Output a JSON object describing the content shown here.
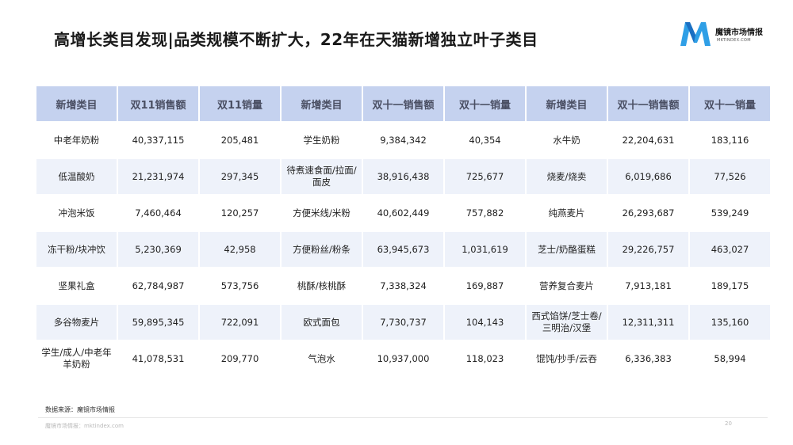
{
  "title": "高增长类目发现|品类规模不断扩大，22年在天猫新增独立叶子类目",
  "logo": {
    "brand": "魔镜市场情报",
    "domain": "MKTINDEX.COM",
    "accent": "#2f9fe6"
  },
  "table": {
    "headers": [
      "新增类目",
      "双11销售额",
      "双11销量",
      "新增类目",
      "双十一销售额",
      "双十一销量",
      "新增类目",
      "双十一销售额",
      "双十一销量"
    ],
    "rows": [
      [
        "中老年奶粉",
        "40,337,115",
        "205,481",
        "学生奶粉",
        "9,384,342",
        "40,354",
        "水牛奶",
        "22,204,631",
        "183,116"
      ],
      [
        "低温酸奶",
        "21,231,974",
        "297,345",
        "待煮速食面/拉面/面皮",
        "38,916,438",
        "725,677",
        "烧麦/烧卖",
        "6,019,686",
        "77,526"
      ],
      [
        "冲泡米饭",
        "7,460,464",
        "120,257",
        "方便米线/米粉",
        "40,602,449",
        "757,882",
        "纯燕麦片",
        "26,293,687",
        "539,249"
      ],
      [
        "冻干粉/块冲饮",
        "5,230,369",
        "42,958",
        "方便粉丝/粉条",
        "63,945,673",
        "1,031,619",
        "芝士/奶酪蛋糕",
        "29,226,757",
        "463,027"
      ],
      [
        "坚果礼盒",
        "62,784,987",
        "573,756",
        "桃酥/核桃酥",
        "7,338,324",
        "169,887",
        "营养复合麦片",
        "7,913,181",
        "189,175"
      ],
      [
        "多谷物麦片",
        "59,895,345",
        "722,091",
        "欧式面包",
        "7,730,737",
        "104,143",
        "西式馅饼/芝士卷/三明治/汉堡",
        "12,311,311",
        "135,160"
      ],
      [
        "学生/成人/中老年羊奶粉",
        "41,078,531",
        "209,770",
        "气泡水",
        "10,937,000",
        "118,023",
        "馄饨/抄手/云吞",
        "6,336,383",
        "58,994"
      ]
    ]
  },
  "source": "数据来源：魔镜市场情报",
  "footer": "魔镜市场情报：mktindex.com",
  "page_number": "20"
}
